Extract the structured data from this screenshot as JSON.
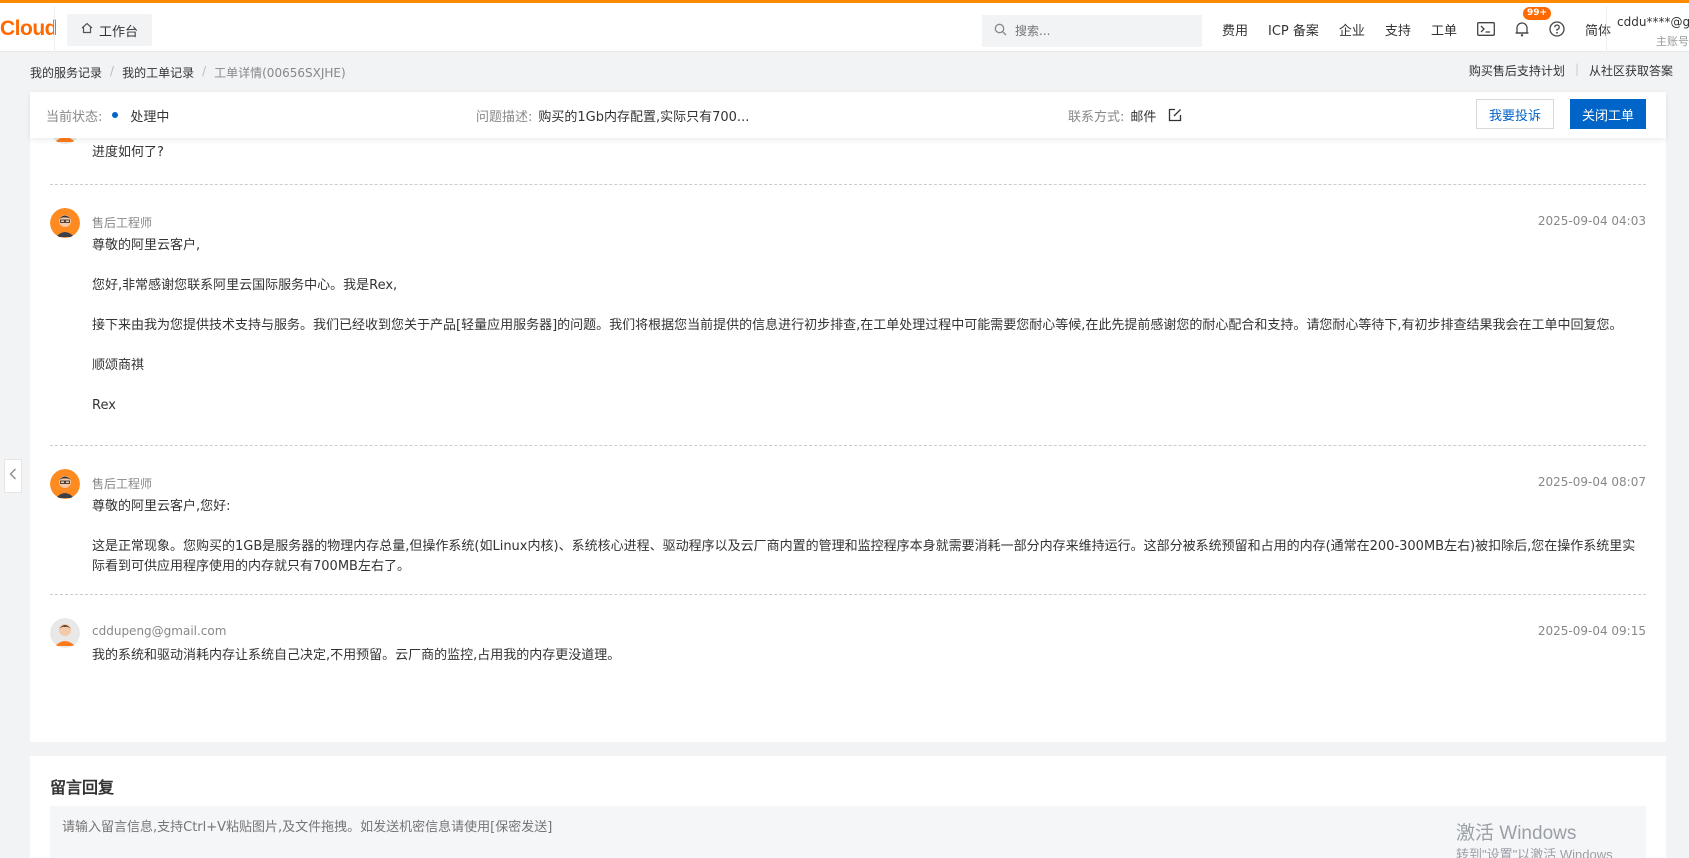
{
  "topbar": {
    "brand": "Cloud",
    "workbench": "工作台",
    "search_placeholder": "搜索...",
    "nav": [
      "费用",
      "ICP 备案",
      "企业",
      "支持",
      "工单"
    ],
    "badge": "99+",
    "lang": "简体",
    "account_email": "cddu****@g...",
    "account_role": "主账号"
  },
  "breadcrumb": {
    "items": [
      "我的服务记录",
      "我的工单记录"
    ],
    "current": "工单详情(00656SXJHE)"
  },
  "right_links": [
    "购买售后支持计划",
    "从社区获取答案"
  ],
  "status_bar": {
    "status_label": "当前状态:",
    "status_value": "处理中",
    "desc_label": "问题描述:",
    "desc_value": "购买的1Gb内存配置,实际只有700...",
    "contact_label": "联系方式:",
    "contact_value": "邮件",
    "complain_button": "我要投诉",
    "close_button": "关闭工单"
  },
  "messages": [
    {
      "body": [
        "进度如何了?"
      ]
    },
    {
      "sender": "售后工程师",
      "time": "2025-09-04 04:03",
      "body": [
        "尊敬的阿里云客户,",
        "您好,非常感谢您联系阿里云国际服务中心。我是Rex,",
        "接下来由我为您提供技术支持与服务。我们已经收到您关于产品[轻量应用服务器]的问题。我们将根据您当前提供的信息进行初步排查,在工单处理过程中可能需要您耐心等候,在此先提前感谢您的耐心配合和支持。请您耐心等待下,有初步排查结果我会在工单中回复您。",
        "顺颂商祺",
        "Rex"
      ]
    },
    {
      "sender": "售后工程师",
      "time": "2025-09-04 08:07",
      "body": [
        "尊敬的阿里云客户,您好:",
        "这是正常现象。您购买的1GB是服务器的物理内存总量,但操作系统(如Linux内核)、系统核心进程、驱动程序以及云厂商内置的管理和监控程序本身就需要消耗一部分内存来维持运行。这部分被系统预留和占用的内存(通常在200-300MB左右)被扣除后,您在操作系统里实际看到可供应用程序使用的内存就只有700MB左右了。"
      ]
    },
    {
      "sender": "cddupeng@gmail.com",
      "time": "2025-09-04 09:15",
      "body": [
        "我的系统和驱动消耗内存让系统自己决定,不用预留。云厂商的监控,占用我的内存更没道理。"
      ]
    }
  ],
  "reply": {
    "title": "留言回复",
    "placeholder": "请输入留言信息,支持Ctrl+V粘贴图片,及文件拖拽。如发送机密信息请使用[保密发送]"
  },
  "watermark": {
    "line1": "激活 Windows",
    "line2": "转到\"设置\"以激活 Windows"
  },
  "colors": {
    "accent_orange": "#ff6a00",
    "primary_blue": "#0064c8"
  }
}
